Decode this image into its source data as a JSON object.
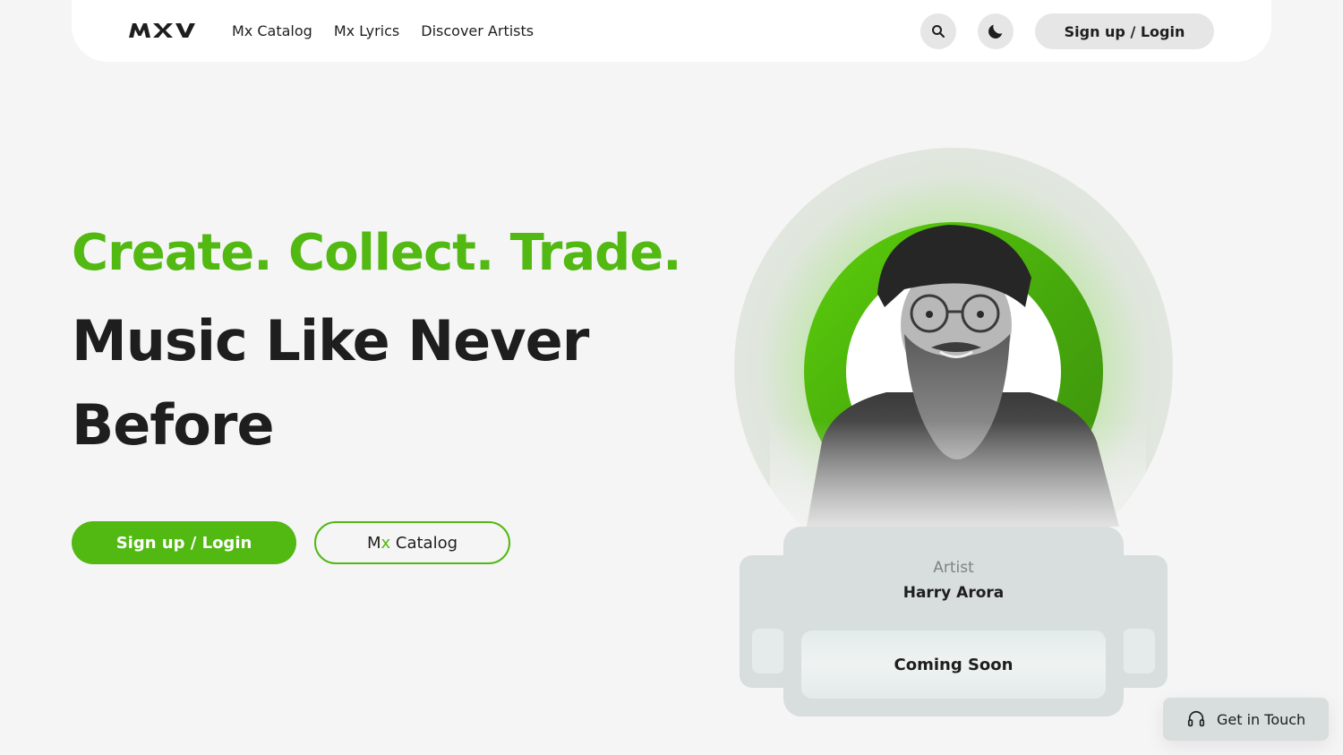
{
  "header": {
    "logo_text": "MXV",
    "nav": [
      "Mx Catalog",
      "Mx Lyrics",
      "Discover Artists"
    ],
    "login_label": "Sign up / Login"
  },
  "hero": {
    "tagline": "Create. Collect. Trade.",
    "headline": "Music Like Never Before",
    "primary_cta": "Sign up / Login",
    "secondary_cta_prefix": "M",
    "secondary_cta_accent": "x",
    "secondary_cta_suffix": " Catalog"
  },
  "artist_card": {
    "label": "Artist",
    "name": "Harry Arora",
    "status": "Coming Soon"
  },
  "contact": {
    "label": "Get in Touch"
  },
  "colors": {
    "accent": "#52b812",
    "background": "#f5f5f5",
    "card": "#d7dedd"
  },
  "icons": [
    "search-icon",
    "moon-icon",
    "headset-icon"
  ]
}
